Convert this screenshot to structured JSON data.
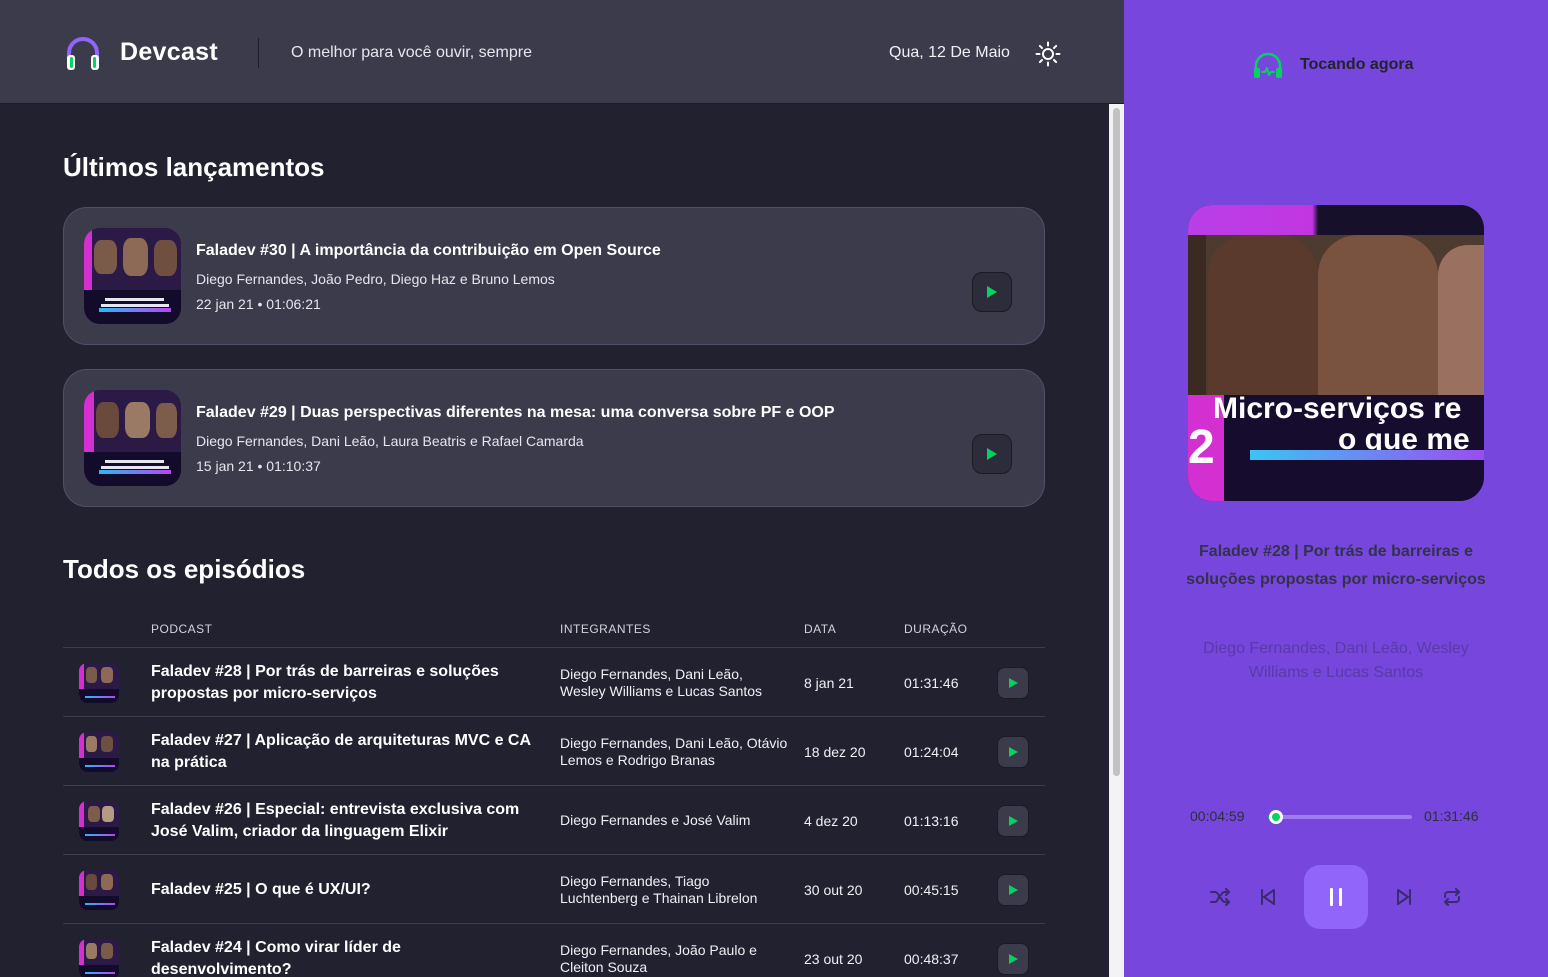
{
  "header": {
    "brand": "Devcast",
    "tagline": "O melhor para você ouvir, sempre",
    "date": "Qua, 12 De Maio",
    "theme_icon": "sun-icon",
    "logo_icon": "headphones-icon"
  },
  "latest": {
    "title": "Últimos lançamentos",
    "items": [
      {
        "title": "Faladev #30 | A importância da contribuição em Open Source",
        "members": "Diego Fernandes, João Pedro, Diego Haz e Bruno Lemos",
        "meta": "22 jan 21 • 01:06:21"
      },
      {
        "title": "Faladev #29 | Duas perspectivas diferentes na mesa: uma conversa sobre PF e OOP",
        "members": "Diego Fernandes, Dani Leão, Laura Beatris e Rafael Camarda",
        "meta": "15 jan 21 • 01:10:37"
      }
    ]
  },
  "all": {
    "title": "Todos os episódios",
    "columns": [
      "PODCAST",
      "INTEGRANTES",
      "DATA",
      "DURAÇÃO"
    ],
    "rows": [
      {
        "title": "Faladev #28 | Por trás de barreiras e soluções propostas por micro-serviços",
        "members": "Diego Fernandes, Dani Leão, Wesley Williams e Lucas Santos",
        "date": "8 jan 21",
        "duration": "01:31:46"
      },
      {
        "title": "Faladev #27 | Aplicação de arquiteturas MVC e CA na prática",
        "members": "Diego Fernandes, Dani Leão, Otávio Lemos e Rodrigo Branas",
        "date": "18 dez 20",
        "duration": "01:24:04"
      },
      {
        "title": "Faladev #26 | Especial: entrevista exclusiva com José Valim, criador da linguagem Elixir",
        "members": "Diego Fernandes e José Valim",
        "date": "4 dez 20",
        "duration": "01:13:16"
      },
      {
        "title": "Faladev #25 | O que é UX/UI?",
        "members": "Diego Fernandes, Tiago Luchtenberg e Thainan Librelon",
        "date": "30 out 20",
        "duration": "00:45:15"
      },
      {
        "title": "Faladev #24 | Como virar líder de desenvolvimento?",
        "members": "Diego Fernandes, João Paulo e Cleiton Souza",
        "date": "23 out 20",
        "duration": "00:48:37"
      }
    ]
  },
  "player": {
    "label": "Tocando agora",
    "cover_text_line1": "Micro-serviços re",
    "cover_text_line2": "o que me",
    "cover_number": "2",
    "title": "Faladev #28 | Por trás de barreiras e soluções propostas por micro-serviços",
    "members": "Diego Fernandes, Dani Leão, Wesley Williams e Lucas Santos",
    "current_time": "00:04:59",
    "total_time": "01:31:46",
    "progress": 0.054
  },
  "colors": {
    "accent_green": "#04d361",
    "player_bg": "#7646dd",
    "main_bg": "#212130",
    "card_bg": "#3b3b4c"
  }
}
